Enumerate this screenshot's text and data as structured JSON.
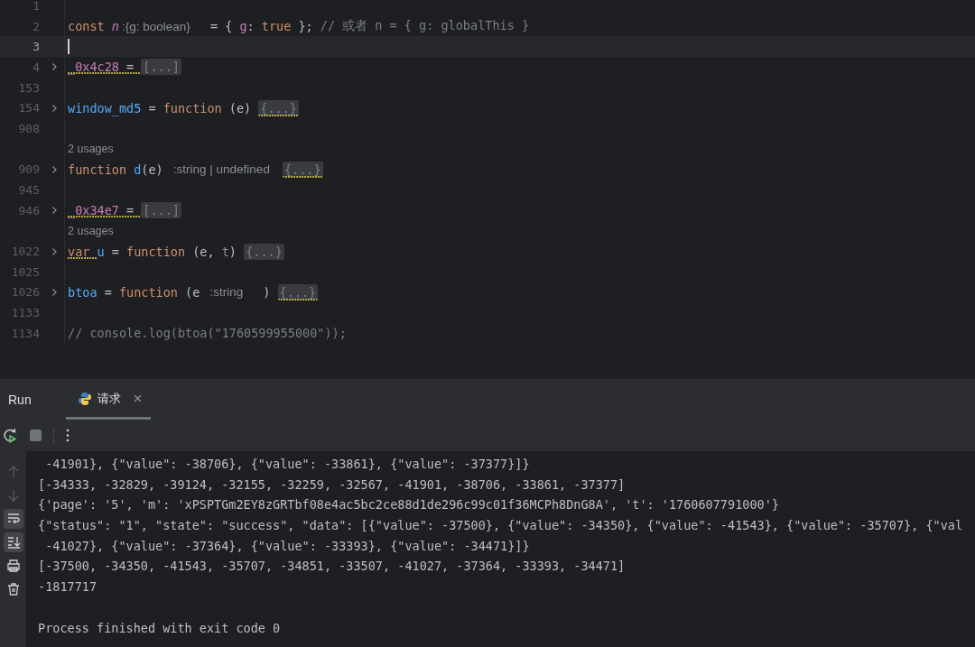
{
  "editor": {
    "lines": [
      {
        "kind": "code",
        "number": "1",
        "current": false,
        "foldable": false
      },
      {
        "kind": "code",
        "number": "2",
        "current": false,
        "foldable": false,
        "tokens": [
          {
            "kind": "keyword",
            "text": "const ",
            "warning": false
          },
          {
            "kind": "var-italic",
            "text": "n",
            "warning": false
          },
          {
            "kind": "hint",
            "text": ":{g: boolean}",
            "warning": false
          },
          {
            "kind": "plain",
            "text": " = { ",
            "warning": false
          },
          {
            "kind": "field",
            "text": "g",
            "warning": false
          },
          {
            "kind": "plain",
            "text": ": ",
            "warning": false
          },
          {
            "kind": "keyword",
            "text": "true",
            "warning": false
          },
          {
            "kind": "plain",
            "text": " }; ",
            "warning": false
          },
          {
            "kind": "comment",
            "text": "// 或者 n = { g: globalThis }",
            "warning": false
          }
        ]
      },
      {
        "kind": "code",
        "number": "3",
        "current": true,
        "foldable": false
      },
      {
        "kind": "code",
        "number": "4",
        "current": false,
        "foldable": true,
        "tokens": [
          {
            "kind": "field",
            "text": "_0x4c28",
            "warning": true
          },
          {
            "kind": "plain",
            "text": " = ",
            "warning": true
          },
          {
            "kind": "folded",
            "text": "[...]",
            "warning": false
          }
        ]
      },
      {
        "kind": "code",
        "number": "153",
        "current": false,
        "foldable": false
      },
      {
        "kind": "code",
        "number": "154",
        "current": false,
        "foldable": true,
        "tokens": [
          {
            "kind": "name",
            "text": "window_md5",
            "warning": false
          },
          {
            "kind": "plain",
            "text": " = ",
            "warning": false
          },
          {
            "kind": "keyword",
            "text": "function",
            "warning": false
          },
          {
            "kind": "plain",
            "text": " (e) ",
            "warning": false
          },
          {
            "kind": "folded",
            "text": "{...}",
            "warning": true
          }
        ]
      },
      {
        "kind": "code",
        "number": "908",
        "current": false,
        "foldable": false
      },
      {
        "kind": "usages",
        "text": "2 usages"
      },
      {
        "kind": "code",
        "number": "909",
        "current": false,
        "foldable": true,
        "tokens": [
          {
            "kind": "keyword",
            "text": "function ",
            "warning": false
          },
          {
            "kind": "name",
            "text": "d",
            "warning": false
          },
          {
            "kind": "plain",
            "text": "(e) ",
            "warning": false
          },
          {
            "kind": "hint",
            "text": ":string | undefined",
            "warning": false
          },
          {
            "kind": "folded",
            "text": "{...}",
            "warning": true
          }
        ]
      },
      {
        "kind": "code",
        "number": "945",
        "current": false,
        "foldable": false
      },
      {
        "kind": "code",
        "number": "946",
        "current": false,
        "foldable": true,
        "tokens": [
          {
            "kind": "field",
            "text": "_0x34e7",
            "warning": true
          },
          {
            "kind": "plain",
            "text": " = ",
            "warning": true
          },
          {
            "kind": "folded",
            "text": "[...]",
            "warning": false
          }
        ]
      },
      {
        "kind": "usages",
        "text": "2 usages"
      },
      {
        "kind": "code",
        "number": "1022",
        "current": false,
        "foldable": true,
        "tokens": [
          {
            "kind": "keyword",
            "text": "var ",
            "warning": true
          },
          {
            "kind": "name",
            "text": "u",
            "warning": false
          },
          {
            "kind": "plain",
            "text": " = ",
            "warning": false
          },
          {
            "kind": "keyword",
            "text": "function",
            "warning": false
          },
          {
            "kind": "plain",
            "text": " (e, ",
            "warning": false
          },
          {
            "kind": "unused",
            "text": "t",
            "warning": false
          },
          {
            "kind": "plain",
            "text": ") ",
            "warning": false
          },
          {
            "kind": "folded",
            "text": "{...}",
            "warning": false
          }
        ]
      },
      {
        "kind": "code",
        "number": "1025",
        "current": false,
        "foldable": false
      },
      {
        "kind": "code",
        "number": "1026",
        "current": false,
        "foldable": true,
        "tokens": [
          {
            "kind": "name",
            "text": "btoa",
            "warning": false
          },
          {
            "kind": "plain",
            "text": " = ",
            "warning": false
          },
          {
            "kind": "keyword",
            "text": "function",
            "warning": false
          },
          {
            "kind": "plain",
            "text": " (e ",
            "warning": false
          },
          {
            "kind": "hint",
            "text": ":string",
            "warning": false
          },
          {
            "kind": "plain",
            "text": " ) ",
            "warning": false
          },
          {
            "kind": "folded",
            "text": "{...}",
            "warning": true
          }
        ]
      },
      {
        "kind": "code",
        "number": "1133",
        "current": false,
        "foldable": false
      },
      {
        "kind": "code",
        "number": "1134",
        "current": false,
        "foldable": false,
        "tokens": [
          {
            "kind": "comment",
            "text": "// console.log(btoa(\"1760599955000\"));",
            "warning": false
          }
        ]
      }
    ]
  },
  "run_panel": {
    "title": "Run",
    "tabs": [
      {
        "label": "请求",
        "selected": true
      }
    ],
    "toolbar": [
      {
        "kind": "rerun"
      },
      {
        "kind": "stop"
      },
      {
        "kind": "more"
      }
    ],
    "side_tools": [
      {
        "kind": "up",
        "on": false,
        "disabled": true
      },
      {
        "kind": "down",
        "on": false,
        "disabled": true
      },
      {
        "kind": "wrap",
        "on": true,
        "disabled": false
      },
      {
        "kind": "scroll-end",
        "on": true,
        "disabled": false
      },
      {
        "kind": "print",
        "on": false,
        "disabled": false
      },
      {
        "kind": "trash",
        "on": false,
        "disabled": false
      }
    ],
    "output": [
      {
        "kind": "line",
        "text": " -41901}, {\"value\": -38706}, {\"value\": -33861}, {\"value\": -37377}]}"
      },
      {
        "kind": "line",
        "text": "[-34333, -32829, -39124, -32155, -32259, -32567, -41901, -38706, -33861, -37377]"
      },
      {
        "kind": "line",
        "text": "{'page': '5', 'm': 'xPSPTGm2EY8zGRTbf08e4ac5bc2ce88d1de296c99c01f36MCPh8DnG8A', 't': '1760607791000'}"
      },
      {
        "kind": "line",
        "text": "{\"status\": \"1\", \"state\": \"success\", \"data\": [{\"value\": -37500}, {\"value\": -34350}, {\"value\": -41543}, {\"value\": -35707}, {\"val"
      },
      {
        "kind": "line",
        "text": " -41027}, {\"value\": -37364}, {\"value\": -33393}, {\"value\": -34471}]}"
      },
      {
        "kind": "line",
        "text": "[-37500, -34350, -41543, -35707, -34851, -33507, -41027, -37364, -33393, -34471]"
      },
      {
        "kind": "line",
        "text": "-1817717"
      },
      {
        "kind": "exit",
        "text": "Process finished with exit code 0"
      }
    ]
  }
}
